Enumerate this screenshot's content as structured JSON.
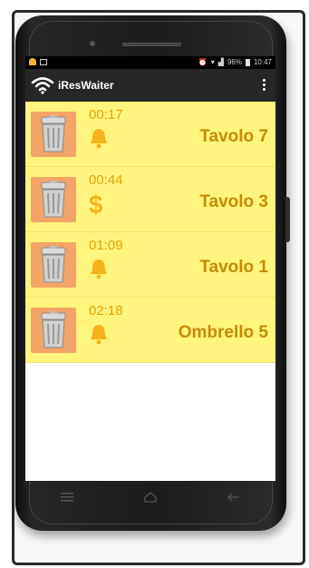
{
  "statusbar": {
    "signal_text": "96%",
    "time": "10:47"
  },
  "app": {
    "title": "iResWaiter"
  },
  "orders": [
    {
      "time": "00:17",
      "status_icon": "bell-icon",
      "table": "Tavolo 7"
    },
    {
      "time": "00:44",
      "status_icon": "dollar-icon",
      "table": "Tavolo 3"
    },
    {
      "time": "01:09",
      "status_icon": "bell-icon",
      "table": "Tavolo 1"
    },
    {
      "time": "02:18",
      "status_icon": "bell-icon",
      "table": "Ombrello 5"
    }
  ],
  "colors": {
    "list_background": "#fff47e",
    "trash_tile": "#f4a467",
    "accent_orange": "#e8a200",
    "table_text": "#c78b05",
    "actionbar": "#262626"
  },
  "navbar": {
    "buttons": [
      "menu-icon",
      "home-icon",
      "back-icon"
    ]
  }
}
